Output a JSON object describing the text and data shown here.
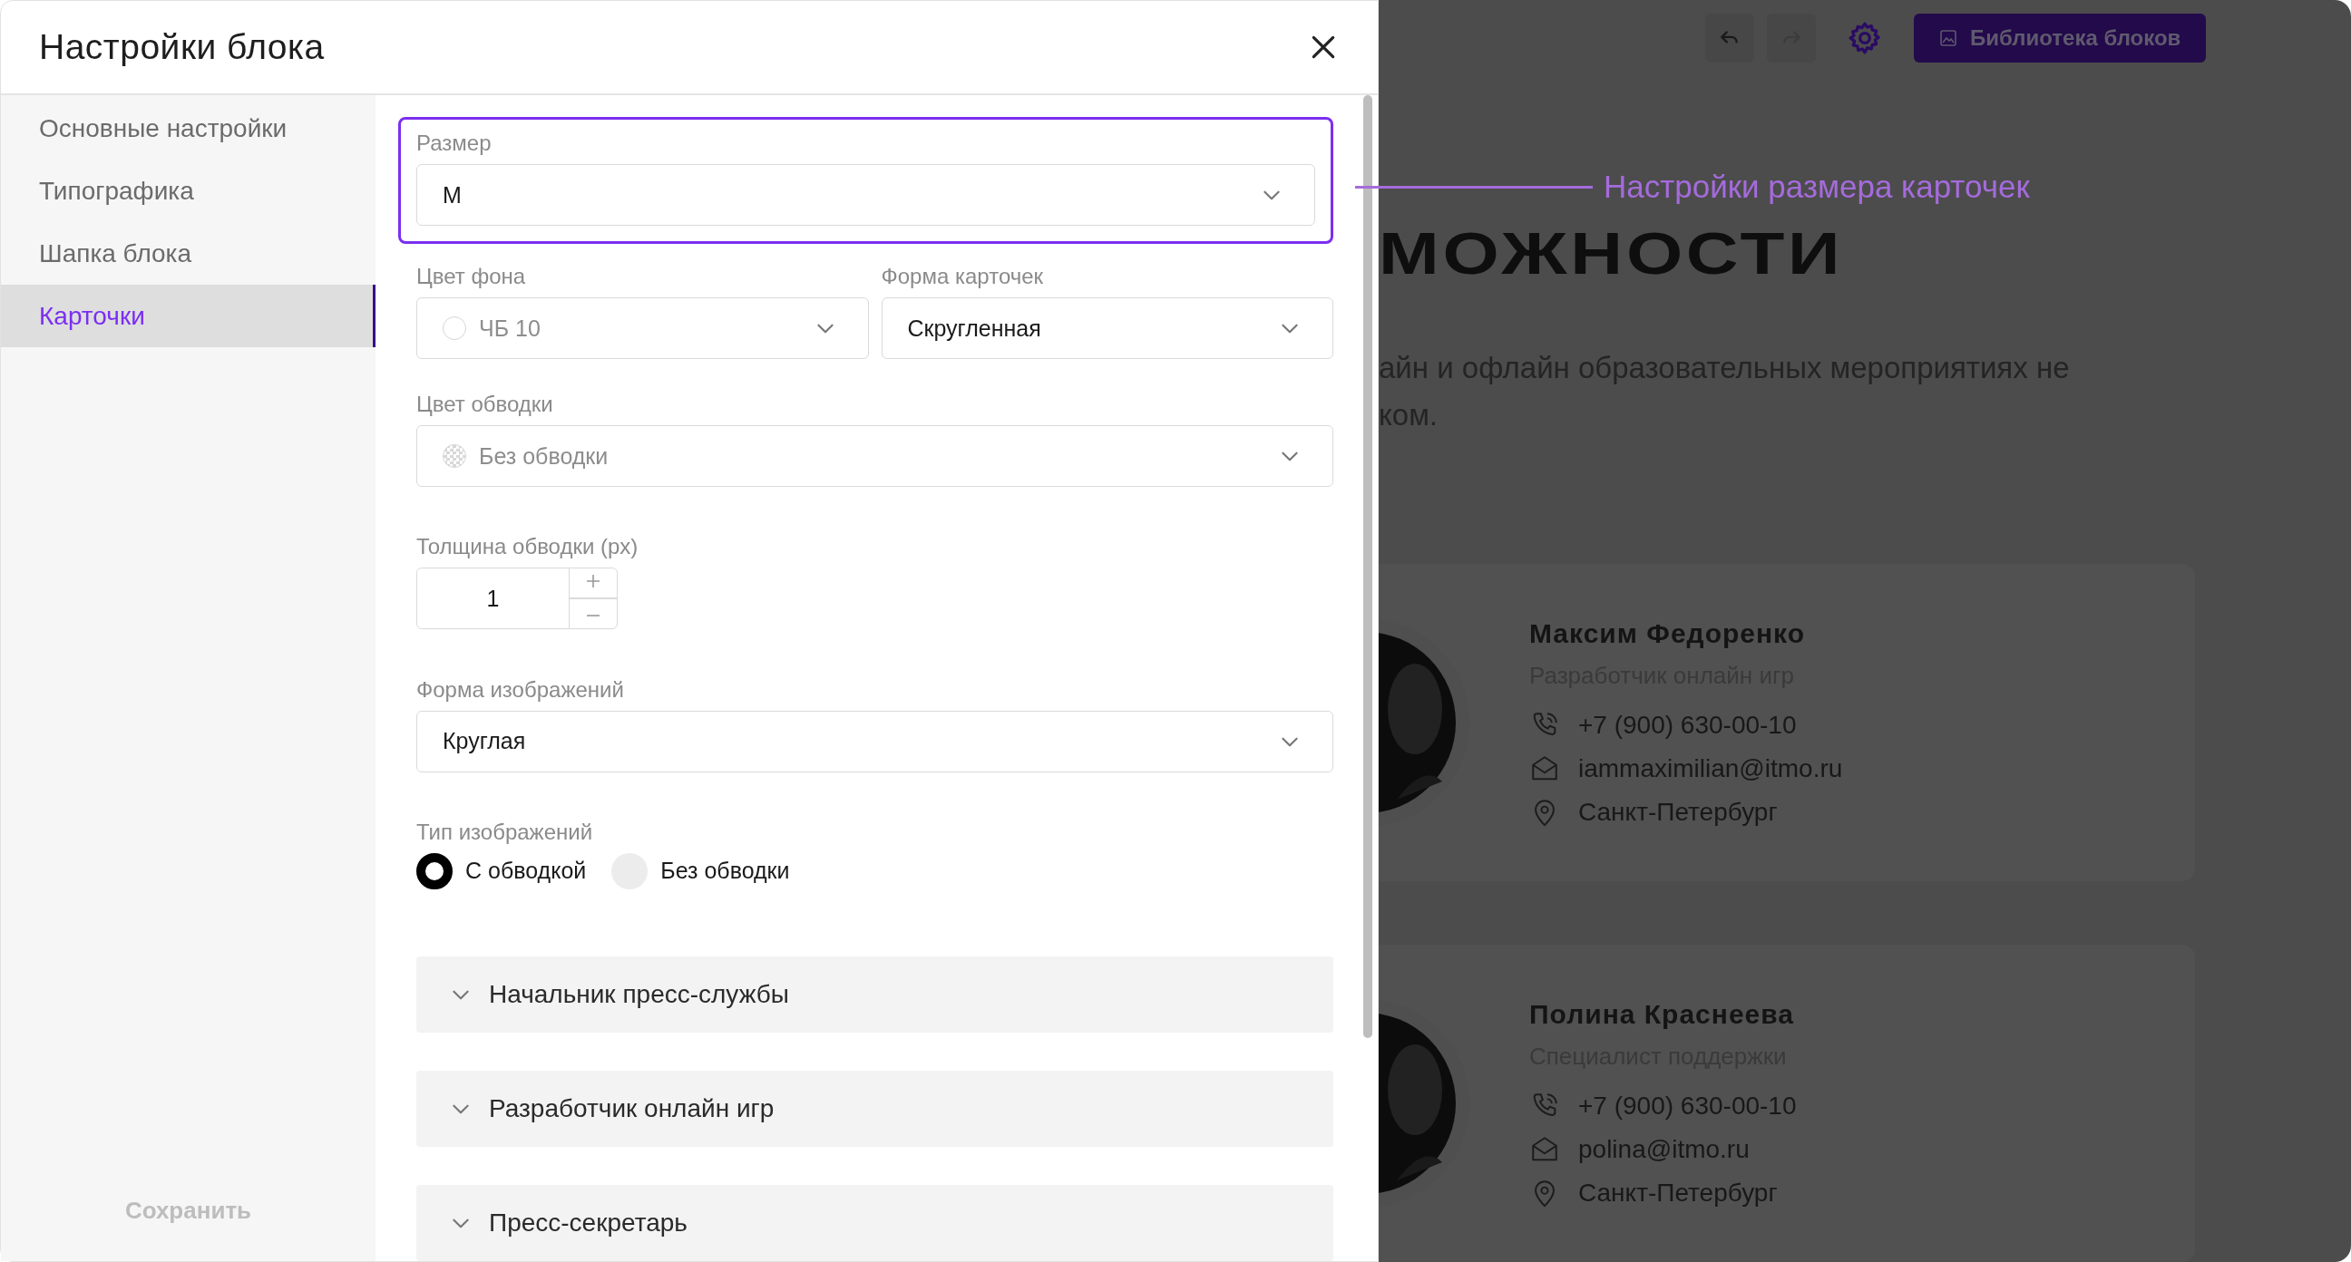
{
  "modal": {
    "title": "Настройки блока"
  },
  "sidebar": {
    "items": [
      {
        "label": "Основные настройки",
        "selected": false
      },
      {
        "label": "Типографика",
        "selected": false
      },
      {
        "label": "Шапка блока",
        "selected": false
      },
      {
        "label": "Карточки",
        "selected": true
      }
    ],
    "save_button": "Сохранить"
  },
  "form": {
    "size": {
      "label": "Размер",
      "value": "M",
      "highlighted": true,
      "disabled": false
    },
    "background_color": {
      "label": "Цвет фона",
      "value": "ЧБ 10",
      "disabled": true,
      "swatch": {
        "kind": "solid",
        "color": "#ffffff"
      }
    },
    "card_shape": {
      "label": "Форма карточек",
      "value": "Скругленная",
      "disabled": false
    },
    "border_color": {
      "label": "Цвет обводки",
      "value": "Без обводки",
      "disabled": true,
      "swatch": {
        "kind": "transparent"
      }
    },
    "border_width": {
      "label": "Толщина обводки (px)",
      "value": "1"
    },
    "image_shape": {
      "label": "Форма изображений",
      "value": "Круглая",
      "disabled": false
    },
    "image_type": {
      "label": "Тип изображений",
      "options": [
        {
          "label": "С обводкой",
          "selected": true
        },
        {
          "label": "Без обводки",
          "selected": false
        }
      ]
    },
    "accordions": [
      {
        "title": "Начальник пресс-службы",
        "expanded": false
      },
      {
        "title": "Разработчик онлайн игр",
        "expanded": false
      },
      {
        "title": "Пресс-секретарь",
        "expanded": false
      }
    ]
  },
  "annotation": {
    "text": "Настройки размера карточек"
  },
  "background_page": {
    "library_button": "Библиотека блоков",
    "heading": "МОЖНОСТИ",
    "paragraph_lines": [
      "айн и офлайн образовательных мероприятиях не",
      "ком."
    ],
    "cards": [
      {
        "name": "Максим Федоренко",
        "role": "Разработчик онлайн игр",
        "phone": "+7 (900) 630-00-10",
        "email": "iammaximilian@itmo.ru",
        "city": "Санкт-Петербург"
      },
      {
        "name": "Полина Краснеева",
        "role": "Специалист поддержки",
        "phone": "+7 (900) 630-00-10",
        "email": "polina@itmo.ru",
        "city": "Санкт-Петербург"
      }
    ]
  }
}
